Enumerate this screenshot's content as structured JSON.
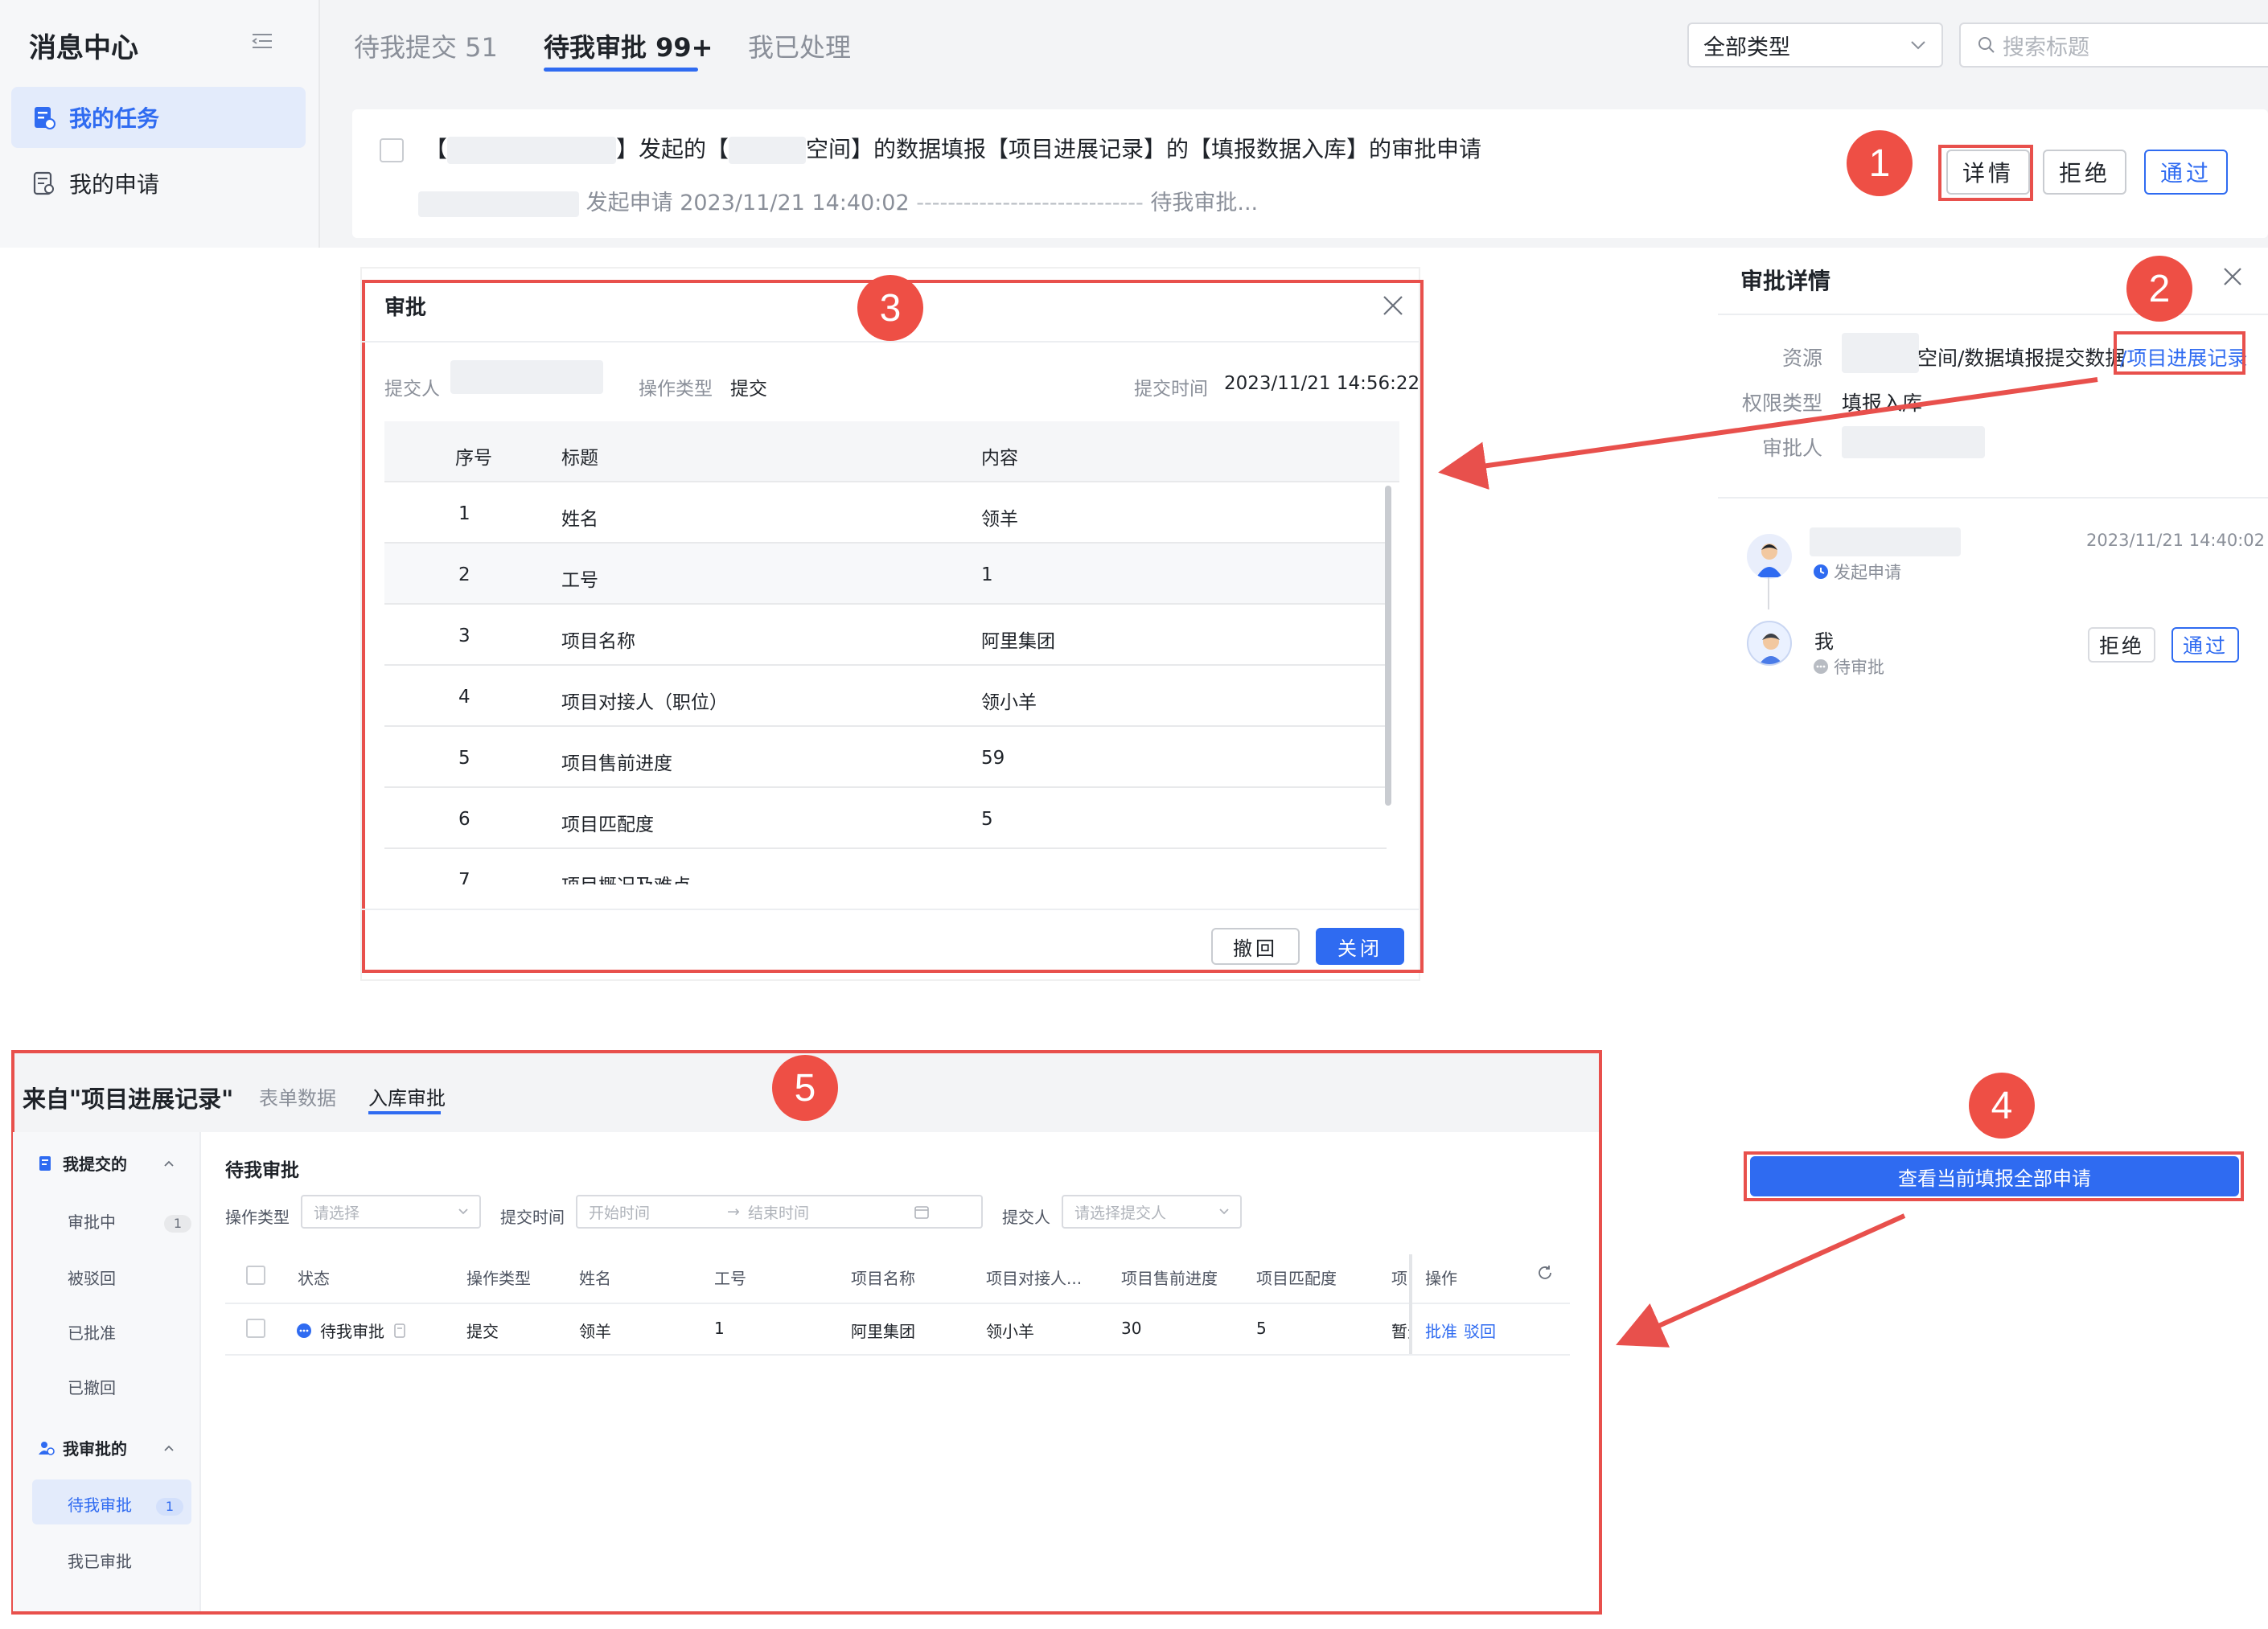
{
  "sidebar": {
    "title": "消息中心",
    "items": [
      {
        "label": "我的任务"
      },
      {
        "label": "我的申请"
      }
    ]
  },
  "tabs": {
    "submit": "待我提交 51",
    "review": "待我审批 99+",
    "done": "我已处理"
  },
  "filters": {
    "type_value": "全部类型",
    "search_placeholder": "搜索标题"
  },
  "task": {
    "title_prefix": "【",
    "title_mid1": "】发起的【",
    "title_mid2": "空间】的数据填报【项目进展记录】的【填报数据入库】的审批申请",
    "meta_initiate": "发起申请",
    "meta_time": "2023/11/21 14:40:02",
    "meta_status": "待我审批...",
    "dashes": "-----------------------------"
  },
  "buttons": {
    "detail": "详情",
    "reject": "拒绝",
    "pass": "通过"
  },
  "annotations": [
    "1",
    "2",
    "3",
    "4",
    "5"
  ],
  "detail": {
    "title": "审批详情",
    "resource_label": "资源",
    "resource_value": "空间/数据填报提交数据",
    "resource_link": "/项目进展记录",
    "perm_label": "权限类型",
    "perm_value": "填报入库",
    "approver_label": "审批人",
    "timeline": [
      {
        "time": "2023/11/21 14:40:02",
        "status": "发起申请"
      },
      {
        "name": "我",
        "status": "待审批"
      }
    ],
    "reject": "拒绝",
    "pass": "通过"
  },
  "modal": {
    "title": "审批",
    "submitter_label": "提交人",
    "op_type_label": "操作类型",
    "op_type_value": "提交",
    "submit_time_label": "提交时间",
    "submit_time_value": "2023/11/21 14:56:22",
    "columns": [
      "序号",
      "标题",
      "内容"
    ],
    "rows": [
      {
        "no": "1",
        "title": "姓名",
        "content": "领羊"
      },
      {
        "no": "2",
        "title": "工号",
        "content": "1"
      },
      {
        "no": "3",
        "title": "项目名称",
        "content": "阿里集团"
      },
      {
        "no": "4",
        "title": "项目对接人（职位）",
        "content": "领小羊"
      },
      {
        "no": "5",
        "title": "项目售前进度",
        "content": "59"
      },
      {
        "no": "6",
        "title": "项目匹配度",
        "content": "5"
      },
      {
        "no": "7",
        "title": "项目概况及难点",
        "content": ""
      }
    ],
    "withdraw": "撤回",
    "close": "关闭"
  },
  "bottom": {
    "title": "来自\"项目进展记录\"",
    "tab_form": "表单数据",
    "tab_review": "入库审批",
    "side": {
      "group1": "我提交的",
      "in_review": "审批中",
      "in_review_count": "1",
      "rejected": "被驳回",
      "approved": "已批准",
      "withdrawn": "已撤回",
      "group2": "我审批的",
      "pending": "待我审批",
      "pending_count": "1",
      "reviewed": "我已审批"
    },
    "section": "待我审批",
    "filters": {
      "op_type_label": "操作类型",
      "op_type_placeholder": "请选择",
      "time_label": "提交时间",
      "start_placeholder": "开始时间",
      "end_placeholder": "结束时间",
      "submitter_label": "提交人",
      "submitter_placeholder": "请选择提交人"
    },
    "columns": [
      "状态",
      "操作类型",
      "姓名",
      "工号",
      "项目名称",
      "项目对接人...",
      "项目售前进度",
      "项目匹配度",
      "项目",
      "操作"
    ],
    "row": {
      "status": "待我审批",
      "op_type": "提交",
      "name": "领羊",
      "emp_no": "1",
      "project": "阿里集团",
      "contact": "领小羊",
      "progress": "30",
      "match": "5",
      "extra": "暂无",
      "approve": "批准",
      "reject": "驳回"
    }
  },
  "view_all_button": "查看当前填报全部申请",
  "colors": {
    "accent": "#2f6bf1",
    "annotation_red": "#ee4f45"
  }
}
